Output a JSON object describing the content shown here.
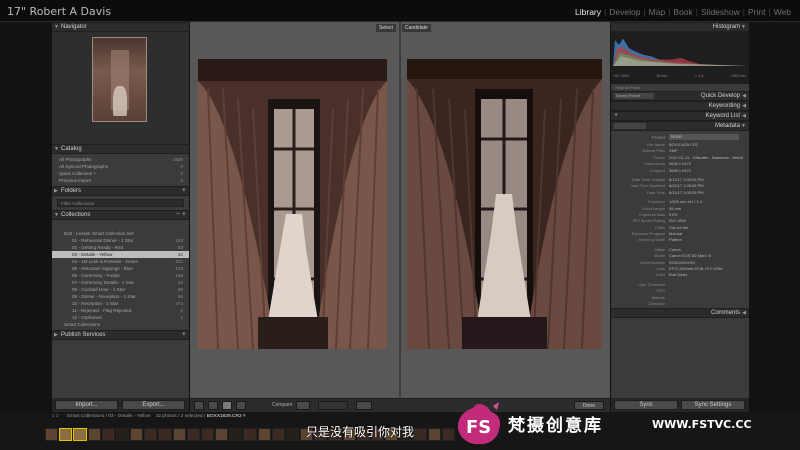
{
  "identity": "17\" Robert A Davis",
  "modules": [
    "Library",
    "Develop",
    "Map",
    "Book",
    "Slideshow",
    "Print",
    "Web"
  ],
  "active_module": "Library",
  "left": {
    "navigator": "Navigator",
    "catalog": "Catalog",
    "catalog_items": [
      {
        "label": "All Photographs",
        "count": "1826"
      },
      {
        "label": "All Synced Photographs",
        "count": "0"
      },
      {
        "label": "Quick Collection +",
        "count": "0"
      },
      {
        "label": "Previous Import",
        "count": "0"
      }
    ],
    "folders": "Folders",
    "filter_placeholder": "Filter Collections",
    "collections": "Collections",
    "collection_items": [
      {
        "label": "Bolt - Lessek Smart Collection Set",
        "count": ""
      },
      {
        "label": "01 - Rehearsal Dinner - 1 Star",
        "count": "153"
      },
      {
        "label": "02 - Getting Ready - Red",
        "count": "53"
      },
      {
        "label": "03 - Details - Yellow",
        "count": "42"
      },
      {
        "label": "04 - 1st Look & Portraits - Green",
        "count": "221"
      },
      {
        "label": "05 - Reluctant Signings - Blue",
        "count": "134"
      },
      {
        "label": "06 - Ceremony - Purple",
        "count": "196"
      },
      {
        "label": "07 - Ceremony Details - 1 Star",
        "count": "24"
      },
      {
        "label": "08 - Cocktail Hour - 1 Star",
        "count": "68"
      },
      {
        "label": "09 - Dinner - Reception - 1 Star",
        "count": "58"
      },
      {
        "label": "10 - Reception - 1 Star",
        "count": "474"
      },
      {
        "label": "11 - Rejected - Flag Rejected",
        "count": "0"
      },
      {
        "label": "12 - Orphaned",
        "count": "1"
      },
      {
        "label": "Smart Collections",
        "count": ""
      }
    ],
    "publish": "Publish Services",
    "import_label": "Import...",
    "export_label": "Export..."
  },
  "center": {
    "select_label": "Select",
    "candidate_label": "Candidate",
    "compare_label": "Compare",
    "done_label": "Done"
  },
  "right": {
    "histogram": "Histogram",
    "hist_readout": [
      "ISO 1600",
      "35 mm",
      "f / 1.4",
      "1/500 sec"
    ],
    "original_photo": "Original Photo",
    "quick_develop": "Quick Develop",
    "saved_preset": "Saved Preset",
    "keywording": "Keywording",
    "keyword_list": "Keyword List",
    "metadata": "Metadata",
    "preset_label": "Preset",
    "preset_value": "None",
    "meta_rows": [
      [
        "File Name",
        "BOXX1829.CR2"
      ],
      [
        "Sidecar Files",
        "XMP"
      ],
      [
        "Folder",
        "2017-01-11 - Gillcutter - Bakeman - Weddi"
      ],
      [
        "Dimensions",
        "3648 x 5472"
      ],
      [
        "Cropped",
        "3648 x 5472"
      ],
      [
        "Date Time Original",
        "8/11/17 1:00:26 PM"
      ],
      [
        "Date Time Digitized",
        "8/11/17 1:00:26 PM"
      ],
      [
        "Date Time",
        "8/11/17 1:00:26 PM"
      ],
      [
        "Exposure",
        "1/500 sec at f / 1.4"
      ],
      [
        "Focal Length",
        "35 mm"
      ],
      [
        "Exposure Bias",
        "0 EV"
      ],
      [
        "ISO Speed Rating",
        "ISO 1600"
      ],
      [
        "Flash",
        "Did not fire"
      ],
      [
        "Exposure Program",
        "Manual"
      ],
      [
        "Metering Mode",
        "Pattern"
      ],
      [
        "Make",
        "Canon"
      ],
      [
        "Model",
        "Canon EOS 5D Mark III"
      ],
      [
        "Serial Number",
        "0530119XXXX"
      ],
      [
        "Lens",
        "EF70-200mm f/2.8L IS II USM"
      ],
      [
        "Artist",
        "Bob Davis"
      ],
      [
        "User Comment",
        ""
      ],
      [
        "GPS",
        ""
      ],
      [
        "Altitude",
        ""
      ],
      [
        "Direction",
        ""
      ]
    ],
    "comments": "Comments",
    "sync_label": "Sync",
    "sync_settings_label": "Sync Settings"
  },
  "filmstrip": {
    "prefix": "1  2",
    "path": "Smart Collections / 03 - Details - Yellow",
    "info": "42 photos / 2 selected /",
    "file": "BOXX1829.CR2",
    "thumbs": 29
  },
  "subtitle": "只是没有吸引你对我",
  "watermark": {
    "logo_text": "FS",
    "name": "梵摄创意库",
    "url": "WWW.FSTVC.CC"
  }
}
